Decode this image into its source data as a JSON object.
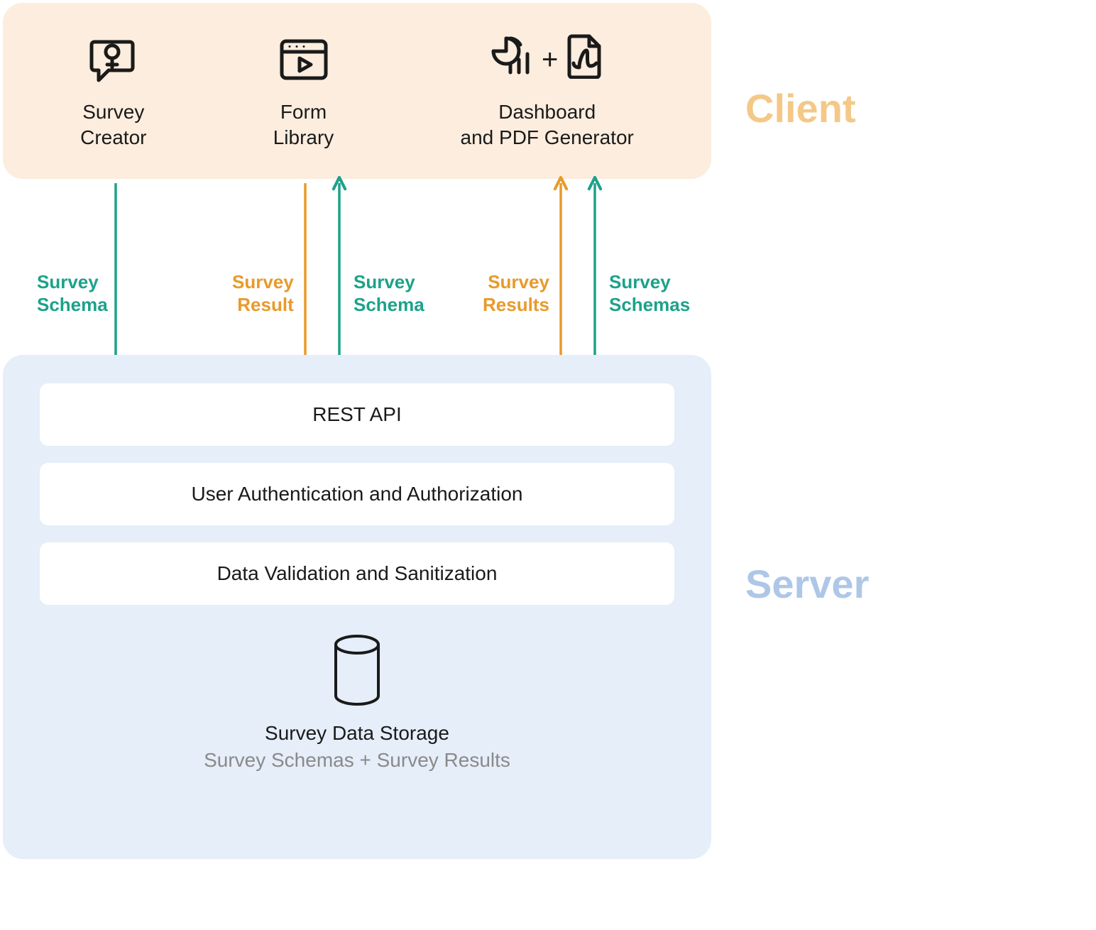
{
  "labels": {
    "client": "Client",
    "server": "Server"
  },
  "client": {
    "items": [
      {
        "line1": "Survey",
        "line2": "Creator"
      },
      {
        "line1": "Form",
        "line2": "Library"
      },
      {
        "line1": "Dashboard",
        "line2": "and PDF Generator"
      }
    ],
    "plus": "+"
  },
  "arrows": {
    "a1": {
      "line1": "Survey",
      "line2": "Schema"
    },
    "a2": {
      "line1": "Survey",
      "line2": "Result"
    },
    "a3": {
      "line1": "Survey",
      "line2": "Schema"
    },
    "a4": {
      "line1": "Survey",
      "line2": "Results"
    },
    "a5": {
      "line1": "Survey",
      "line2": "Schemas"
    }
  },
  "server": {
    "layers": [
      "REST API",
      "User Authentication and Authorization",
      "Data Validation and Sanitization"
    ],
    "storage": {
      "title": "Survey Data Storage",
      "sub": "Survey Schemas + Survey Results"
    }
  }
}
